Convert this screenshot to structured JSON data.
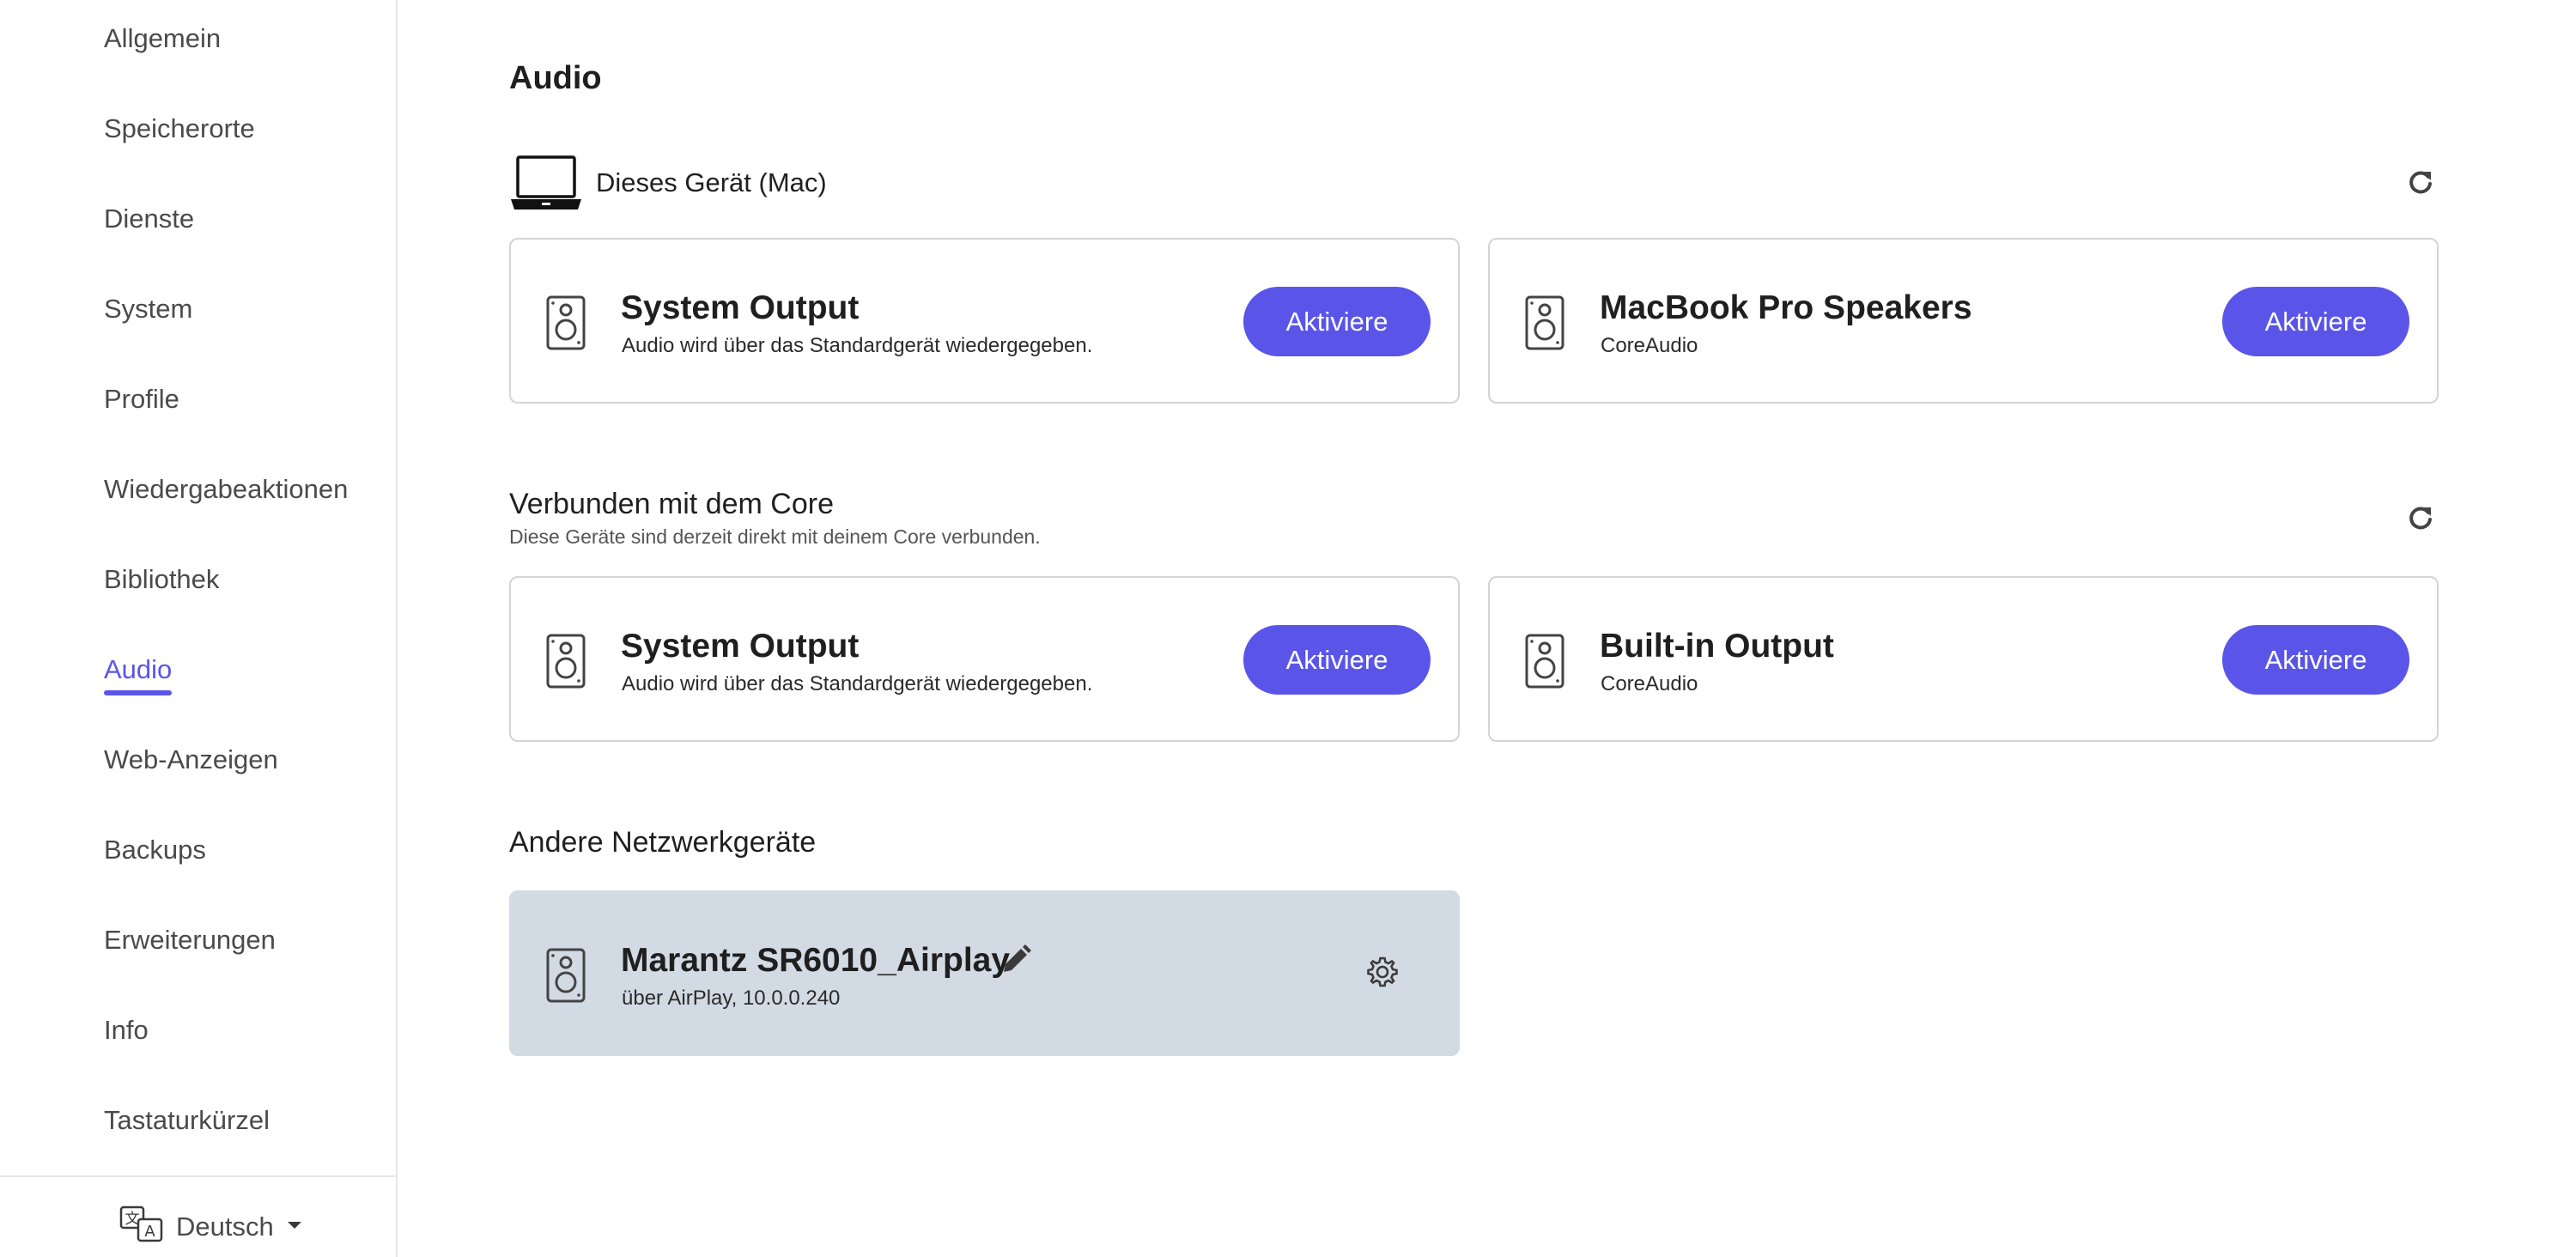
{
  "sidebar": {
    "items": [
      {
        "label": "Allgemein"
      },
      {
        "label": "Speicherorte"
      },
      {
        "label": "Dienste"
      },
      {
        "label": "System"
      },
      {
        "label": "Profile"
      },
      {
        "label": "Wiedergabeaktionen"
      },
      {
        "label": "Bibliothek"
      },
      {
        "label": "Audio"
      },
      {
        "label": "Web-Anzeigen"
      },
      {
        "label": "Backups"
      },
      {
        "label": "Erweiterungen"
      },
      {
        "label": "Info"
      },
      {
        "label": "Tastaturkürzel"
      }
    ],
    "active": "Audio",
    "language": {
      "label": "Deutsch",
      "icon": "translate-icon"
    }
  },
  "main": {
    "title": "Audio",
    "this_device": {
      "label": "Dieses Gerät (Mac)",
      "icon": "laptop-icon",
      "cards": [
        {
          "title": "System Output",
          "subtitle": "Audio wird über das Standardgerät wiedergegeben.",
          "button": "Aktiviere"
        },
        {
          "title": "MacBook Pro Speakers",
          "subtitle": "CoreAudio",
          "button": "Aktiviere"
        }
      ]
    },
    "core": {
      "heading": "Verbunden mit dem Core",
      "description": "Diese Geräte sind derzeit direkt mit deinem Core verbunden.",
      "cards": [
        {
          "title": "System Output",
          "subtitle": "Audio wird über das Standardgerät wiedergegeben.",
          "button": "Aktiviere"
        },
        {
          "title": "Built-in Output",
          "subtitle": "CoreAudio",
          "button": "Aktiviere"
        }
      ]
    },
    "network": {
      "heading": "Andere Netzwerkgeräte",
      "cards": [
        {
          "title": "Marantz SR6010_Airplay",
          "subtitle": "über AirPlay, 10.0.0.240"
        }
      ]
    }
  },
  "colors": {
    "accent": "#5a55e8",
    "card_border": "#d4d4d4",
    "disabled_card": "#d2dae3"
  }
}
